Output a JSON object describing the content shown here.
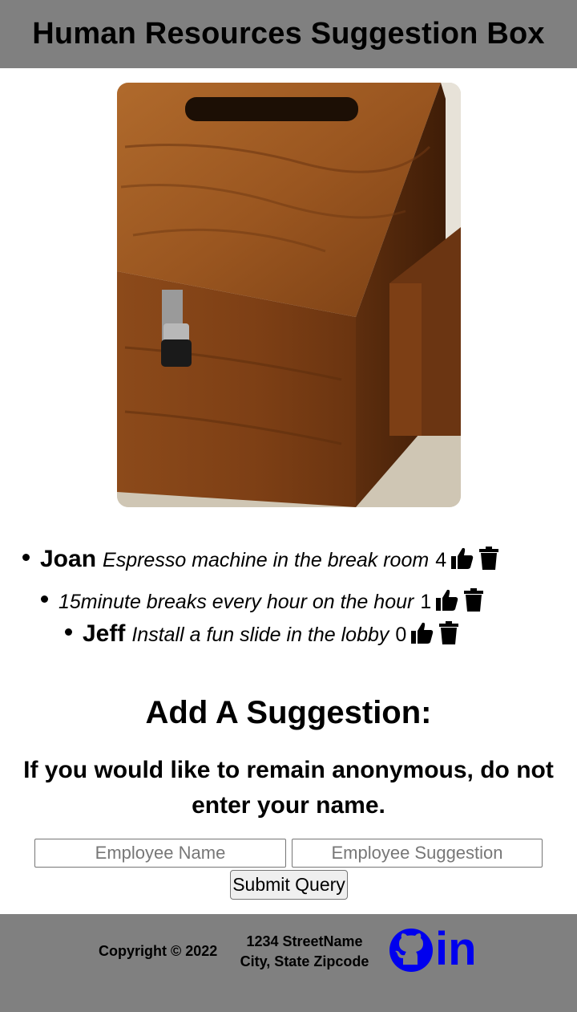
{
  "header": {
    "title": "Human Resources Suggestion Box"
  },
  "suggestions": [
    {
      "name": "Joan",
      "text": "Espresso machine in the break room",
      "votes": "4"
    },
    {
      "name": "",
      "text": "15minute breaks every hour on the hour",
      "votes": "1"
    },
    {
      "name": "Jeff",
      "text": "Install a fun slide in the lobby",
      "votes": "0"
    }
  ],
  "form": {
    "title": "Add A Suggestion:",
    "anon_note": "If you would like to remain anonymous, do not enter your name.",
    "name_placeholder": "Employee Name",
    "suggestion_placeholder": "Employee Suggestion",
    "submit_label": "Submit Query"
  },
  "footer": {
    "copyright": "Copyright © 2022",
    "address_line1": "1234 StreetName",
    "address_line2": "City, State Zipcode",
    "linkedin_label": "in"
  },
  "icons": {
    "like": "thumbs-up-icon",
    "delete": "trash-icon",
    "github": "github-icon",
    "linkedin": "linkedin-icon"
  },
  "colors": {
    "header_bg": "#808080",
    "footer_bg": "#808080",
    "link": "#0000ee"
  }
}
